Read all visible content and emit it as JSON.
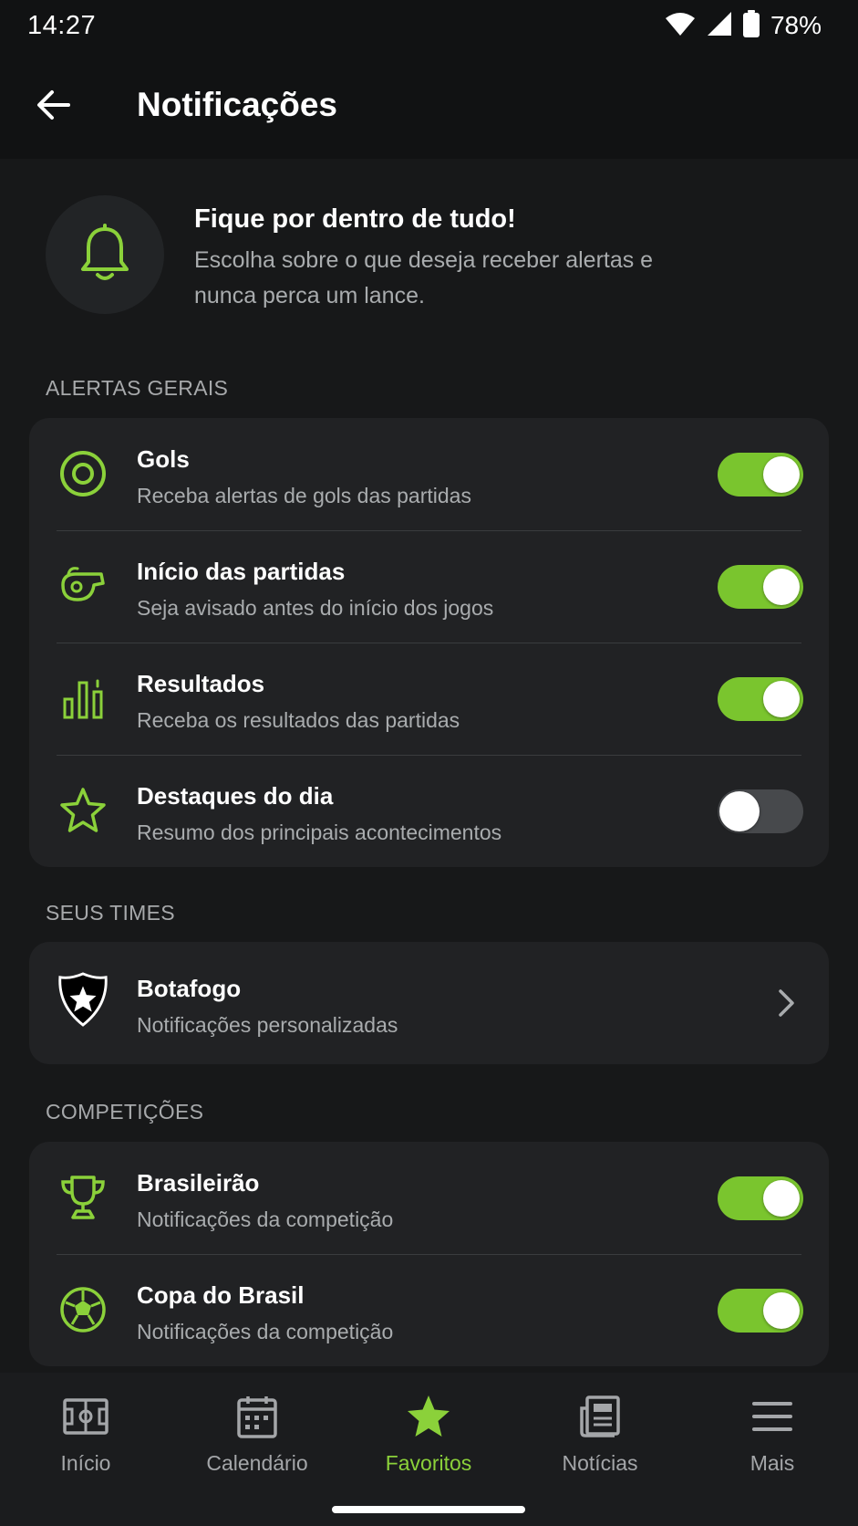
{
  "status_bar": {
    "time": "14:27",
    "battery": "78%",
    "icons": [
      "wifi-icon",
      "signal-icon",
      "battery-icon"
    ]
  },
  "app_bar": {
    "back_icon": "arrow-left-icon",
    "title": "Notificações"
  },
  "intro": {
    "icon": "bell-icon",
    "title": "Fique por dentro de tudo!",
    "subtitle": "Escolha sobre o que deseja receber alertas e nunca perca um lance."
  },
  "sections": {
    "general": {
      "label": "ALERTAS GERAIS",
      "items": [
        {
          "icon": "target-icon",
          "title": "Gols",
          "subtitle": "Receba alertas de gols das partidas",
          "enabled": true
        },
        {
          "icon": "whistle-icon",
          "title": "Início das partidas",
          "subtitle": "Seja avisado antes do início dos jogos",
          "enabled": true
        },
        {
          "icon": "bar-chart-icon",
          "title": "Resultados",
          "subtitle": "Receba os resultados das partidas",
          "enabled": true
        },
        {
          "icon": "star-icon",
          "title": "Destaques do dia",
          "subtitle": "Resumo dos principais acontecimentos",
          "enabled": false
        }
      ]
    },
    "teams": {
      "label": "SEUS TIMES",
      "items": [
        {
          "icon": "botafogo-shield-icon",
          "title": "Botafogo",
          "subtitle": "Notificações personalizadas",
          "trailing_icon": "chevron-right-icon"
        }
      ]
    },
    "competitions": {
      "label": "COMPETIÇÕES",
      "items": [
        {
          "icon": "trophy-icon",
          "title": "Brasileirão",
          "subtitle": "Notificações da competição",
          "enabled": true
        },
        {
          "icon": "soccer-ball-icon",
          "title": "Copa do Brasil",
          "subtitle": "Notificações da competição",
          "enabled": true
        }
      ]
    }
  },
  "bottom_nav": {
    "items": [
      {
        "icon": "field-icon",
        "label": "Início",
        "active": false
      },
      {
        "icon": "calendar-icon",
        "label": "Calendário",
        "active": false
      },
      {
        "icon": "star-icon",
        "label": "Favoritos",
        "active": true
      },
      {
        "icon": "newspaper-icon",
        "label": "Notícias",
        "active": false
      },
      {
        "icon": "menu-icon",
        "label": "Mais",
        "active": false
      }
    ]
  },
  "colors": {
    "accent": "#8bd13a",
    "toggle_on": "#7ac52e",
    "background": "#171819",
    "card": "#212224"
  }
}
